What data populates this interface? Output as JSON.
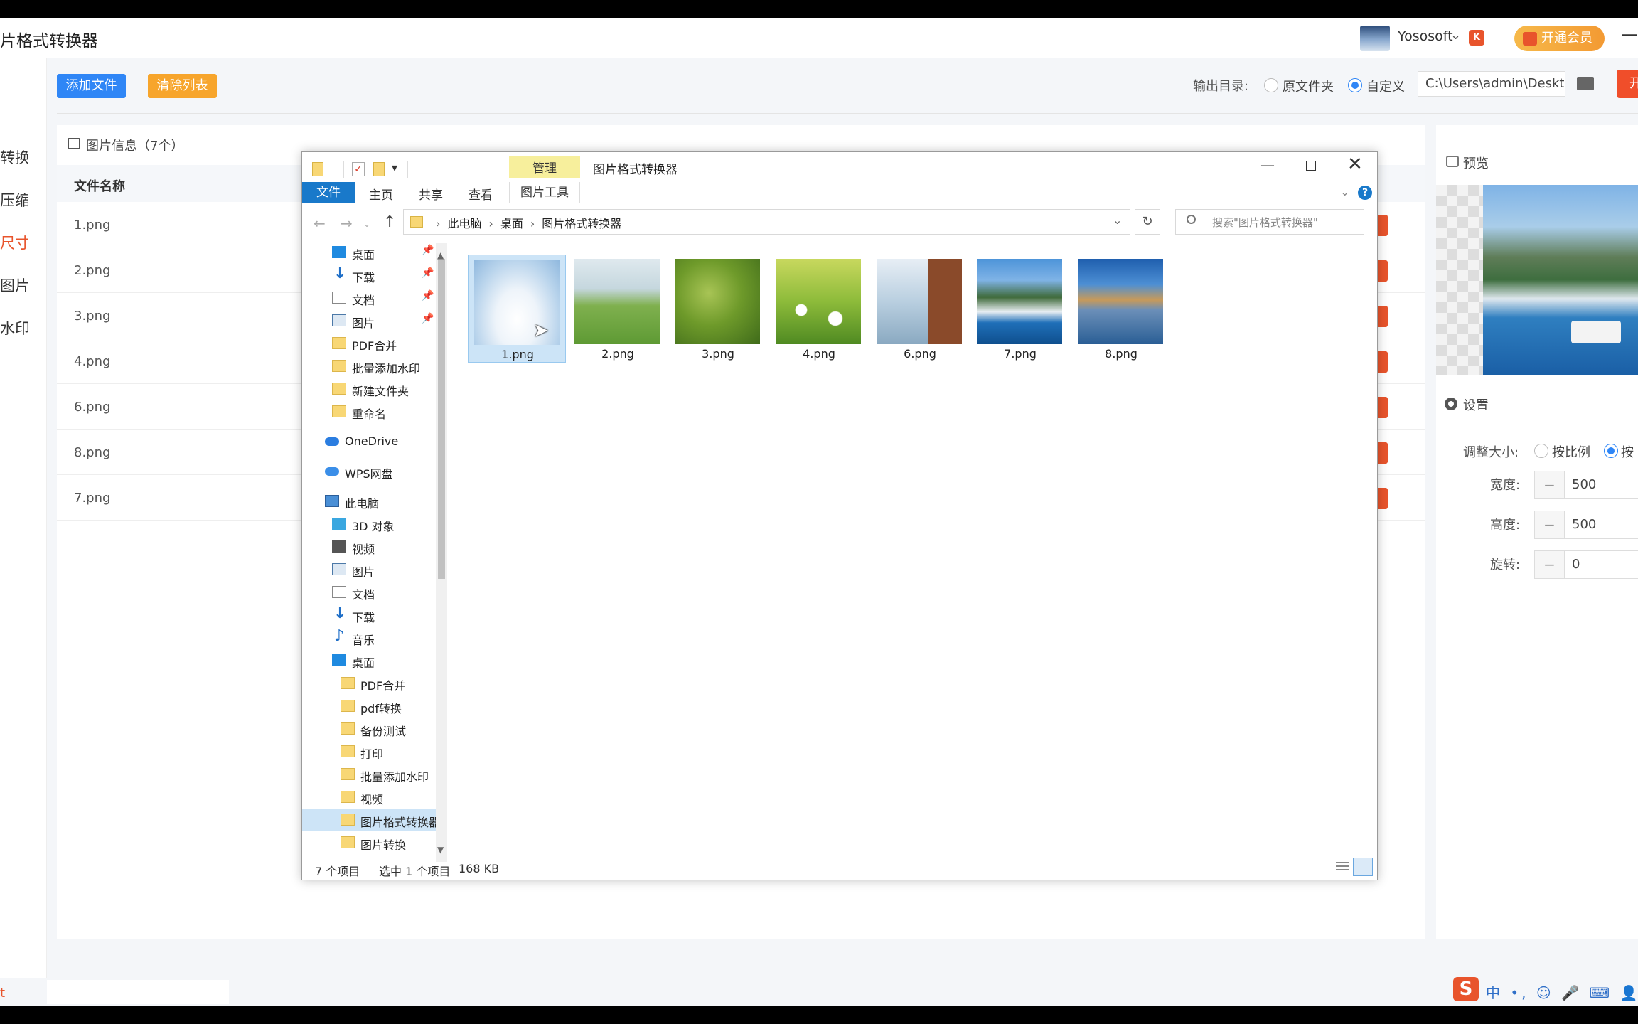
{
  "app": {
    "title": "片格式转换器",
    "user_name": "Yososoft",
    "user_chevron": "⌄",
    "vip_label": "开通会员",
    "minimize": "—"
  },
  "leftnav": [
    "转换",
    "压缩",
    "尺寸",
    "图片",
    "水印"
  ],
  "toolbar": {
    "add_label": "添加文件",
    "clear_label": "清除列表",
    "output_label": "输出目录:",
    "option_original": "原文件夹",
    "option_custom": "自定义",
    "output_path": "C:\\Users\\admin\\Deskto",
    "start_label": "开"
  },
  "list": {
    "title": "图片信息（7个）",
    "column_name": "文件名称",
    "rows": [
      "1.png",
      "2.png",
      "3.png",
      "4.png",
      "6.png",
      "8.png",
      "7.png"
    ]
  },
  "preview": {
    "title": "预览"
  },
  "settings": {
    "title": "设置",
    "resize_label": "调整大小:",
    "opt_ratio": "按比例",
    "opt_pixel": "按",
    "width_label": "宽度:",
    "width_value": "500",
    "height_label": "高度:",
    "height_value": "500",
    "rotate_label": "旋转:",
    "rotate_value": "0"
  },
  "statusbar": {
    "left_text": "t"
  },
  "ime": {
    "logo": "S",
    "items": "中 •, ☺ 🎤 ⌨ 👤 👕"
  },
  "explorer": {
    "manage_tab": "管理",
    "window_title": "图片格式转换器",
    "tabs": {
      "file": "文件",
      "home": "主页",
      "share": "共享",
      "view": "查看",
      "pictools": "图片工具"
    },
    "breadcrumb": [
      "此电脑",
      "桌面",
      "图片格式转换器"
    ],
    "search_placeholder": "搜索\"图片格式转换器\"",
    "tree": [
      {
        "label": "桌面",
        "icon": "desktop",
        "pinned": true
      },
      {
        "label": "下载",
        "icon": "download",
        "pinned": true
      },
      {
        "label": "文档",
        "icon": "document",
        "pinned": true
      },
      {
        "label": "图片",
        "icon": "picture",
        "pinned": true
      },
      {
        "label": "PDF合并",
        "icon": "folder"
      },
      {
        "label": "批量添加水印",
        "icon": "folder"
      },
      {
        "label": "新建文件夹",
        "icon": "folder"
      },
      {
        "label": "重命名",
        "icon": "folder"
      },
      {
        "label": "OneDrive",
        "icon": "cloud"
      },
      {
        "label": "WPS网盘",
        "icon": "cloud"
      },
      {
        "label": "此电脑",
        "icon": "pc"
      },
      {
        "label": "3D 对象",
        "icon": "3d"
      },
      {
        "label": "视频",
        "icon": "video"
      },
      {
        "label": "图片",
        "icon": "picture"
      },
      {
        "label": "文档",
        "icon": "document"
      },
      {
        "label": "下载",
        "icon": "download"
      },
      {
        "label": "音乐",
        "icon": "music"
      },
      {
        "label": "桌面",
        "icon": "desktop"
      },
      {
        "label": "PDF合并",
        "icon": "folder"
      },
      {
        "label": "pdf转换",
        "icon": "folder"
      },
      {
        "label": "备份测试",
        "icon": "folder"
      },
      {
        "label": "打印",
        "icon": "folder"
      },
      {
        "label": "批量添加水印",
        "icon": "folder"
      },
      {
        "label": "视频",
        "icon": "folder"
      },
      {
        "label": "图片格式转换器",
        "icon": "folder",
        "selected": true
      },
      {
        "label": "图片转换",
        "icon": "folder"
      }
    ],
    "files": [
      "1.png",
      "2.png",
      "3.png",
      "4.png",
      "6.png",
      "7.png",
      "8.png"
    ],
    "status": {
      "count": "7 个项目",
      "selected": "选中 1 个项目",
      "size": "168 KB"
    }
  }
}
